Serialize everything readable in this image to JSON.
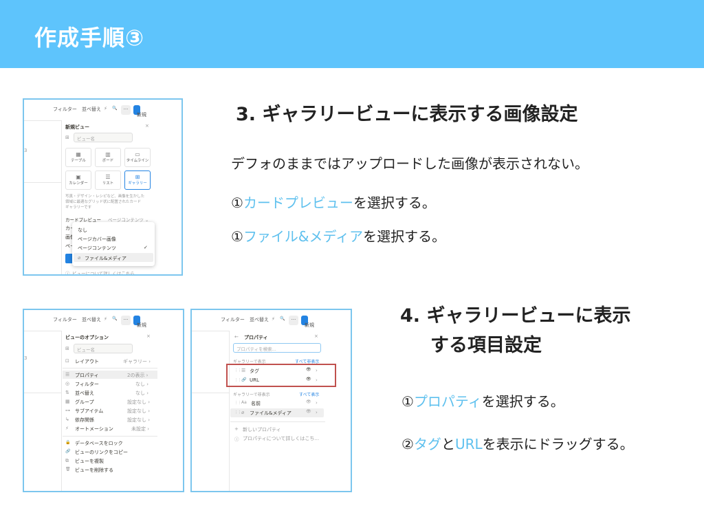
{
  "header": {
    "title": "作成手順③"
  },
  "section3": {
    "heading": "3. ギャラリービューに表示する画像設定",
    "desc": "デフォのままではアップロードした画像が表示されない。",
    "step1_num": "①",
    "step1_hl": "カードプレビュー",
    "step1_rest": "を選択する。",
    "step2_num": "①",
    "step2_hl": "ファイル&メディア",
    "step2_rest": "を選択する。"
  },
  "section4": {
    "heading_line1": "4. ギャラリービューに表示",
    "heading_line2": "する項目設定",
    "step1_num": "①",
    "step1_hl": "プロパティ",
    "step1_rest": "を選択する。",
    "step2_num": "②",
    "step2_hl1": "タグ",
    "step2_mid": "と",
    "step2_hl2": "URL",
    "step2_rest": "を表示にドラッグする。"
  },
  "toolbar": {
    "filter": "フィルター",
    "sort": "並べ替え",
    "bolt": "⚡",
    "search": "🔍",
    "more": "···",
    "new": "新規",
    "chev": "⌄"
  },
  "shot1": {
    "panel_title": "新規ビュー",
    "close": "×",
    "name_placeholder": "ビュー名",
    "layouts": [
      {
        "icon": "▦",
        "label": "テーブル"
      },
      {
        "icon": "▥",
        "label": "ボード"
      },
      {
        "icon": "▭",
        "label": "タイムライン"
      },
      {
        "icon": "▣",
        "label": "カレンダー"
      },
      {
        "icon": "☰",
        "label": "リスト"
      },
      {
        "icon": "⊞",
        "label": "ギャラリー"
      }
    ],
    "gallery_desc1": "写真・デザイン・レシピなど、画像を生かした",
    "gallery_desc2": "領域に最適なグリッド状に配置されたカード",
    "gallery_desc3": "ギャラリーです",
    "card_preview_label": "カードプレビュー",
    "card_preview_value": "ページコンテンツ ⌄",
    "peek1": "カー",
    "peek2": "画像",
    "peek3": "ページ",
    "dropdown": [
      "なし",
      "ページカバー画像",
      "ページコンテンツ",
      "ファイル&メディア"
    ],
    "check": "✓",
    "clip": "⌀",
    "footer_link": "ビューについて詳しくはこちら"
  },
  "shot2": {
    "panel_title": "ビューのオプション",
    "close": "×",
    "name_placeholder": "ビュー名",
    "layout_label": "レイアウト",
    "layout_value": "ギャラリー ›",
    "rows": [
      {
        "icon": "☰",
        "label": "プロパティ",
        "value": "2の表示 ›"
      },
      {
        "icon": "◎",
        "label": "フィルター",
        "value": "なし ›"
      },
      {
        "icon": "⇅",
        "label": "並べ替え",
        "value": "なし ›"
      },
      {
        "icon": "▦",
        "label": "グループ",
        "value": "設定なし ›"
      },
      {
        "icon": "⊶",
        "label": "サブアイテム",
        "value": "設定なし ›"
      },
      {
        "icon": "↳",
        "label": "依存関係",
        "value": "設定なし ›"
      },
      {
        "icon": "⚡",
        "label": "オートメーション",
        "value": "未設定 ›"
      }
    ],
    "actions": [
      {
        "icon": "🔒",
        "label": "データベースをロック"
      },
      {
        "icon": "🔗",
        "label": "ビューのリンクをコピー"
      },
      {
        "icon": "⧉",
        "label": "ビューを複製"
      },
      {
        "icon": "🗑",
        "label": "ビューを削除する"
      }
    ]
  },
  "shot3": {
    "back": "←",
    "panel_title": "プロパティ",
    "close": "×",
    "search_placeholder": "プロパティを検索...",
    "shown_label": "ギャラリーで表示",
    "hide_all": "すべて非表示",
    "shown": [
      {
        "icon": "☰",
        "label": "タグ"
      },
      {
        "icon": "🔗",
        "label": "URL"
      }
    ],
    "hidden_label": "ギャラリーで非表示",
    "show_all": "すべて表示",
    "hidden": [
      {
        "icon": "Aa",
        "label": "名前"
      },
      {
        "icon": "⌀",
        "label": "ファイル&メディア"
      }
    ],
    "eye": "👁",
    "arrow": "›",
    "handle": "⋮⋮",
    "new_prop": "新しいプロパティ",
    "help": "プロパティについて詳しくはこち..."
  }
}
